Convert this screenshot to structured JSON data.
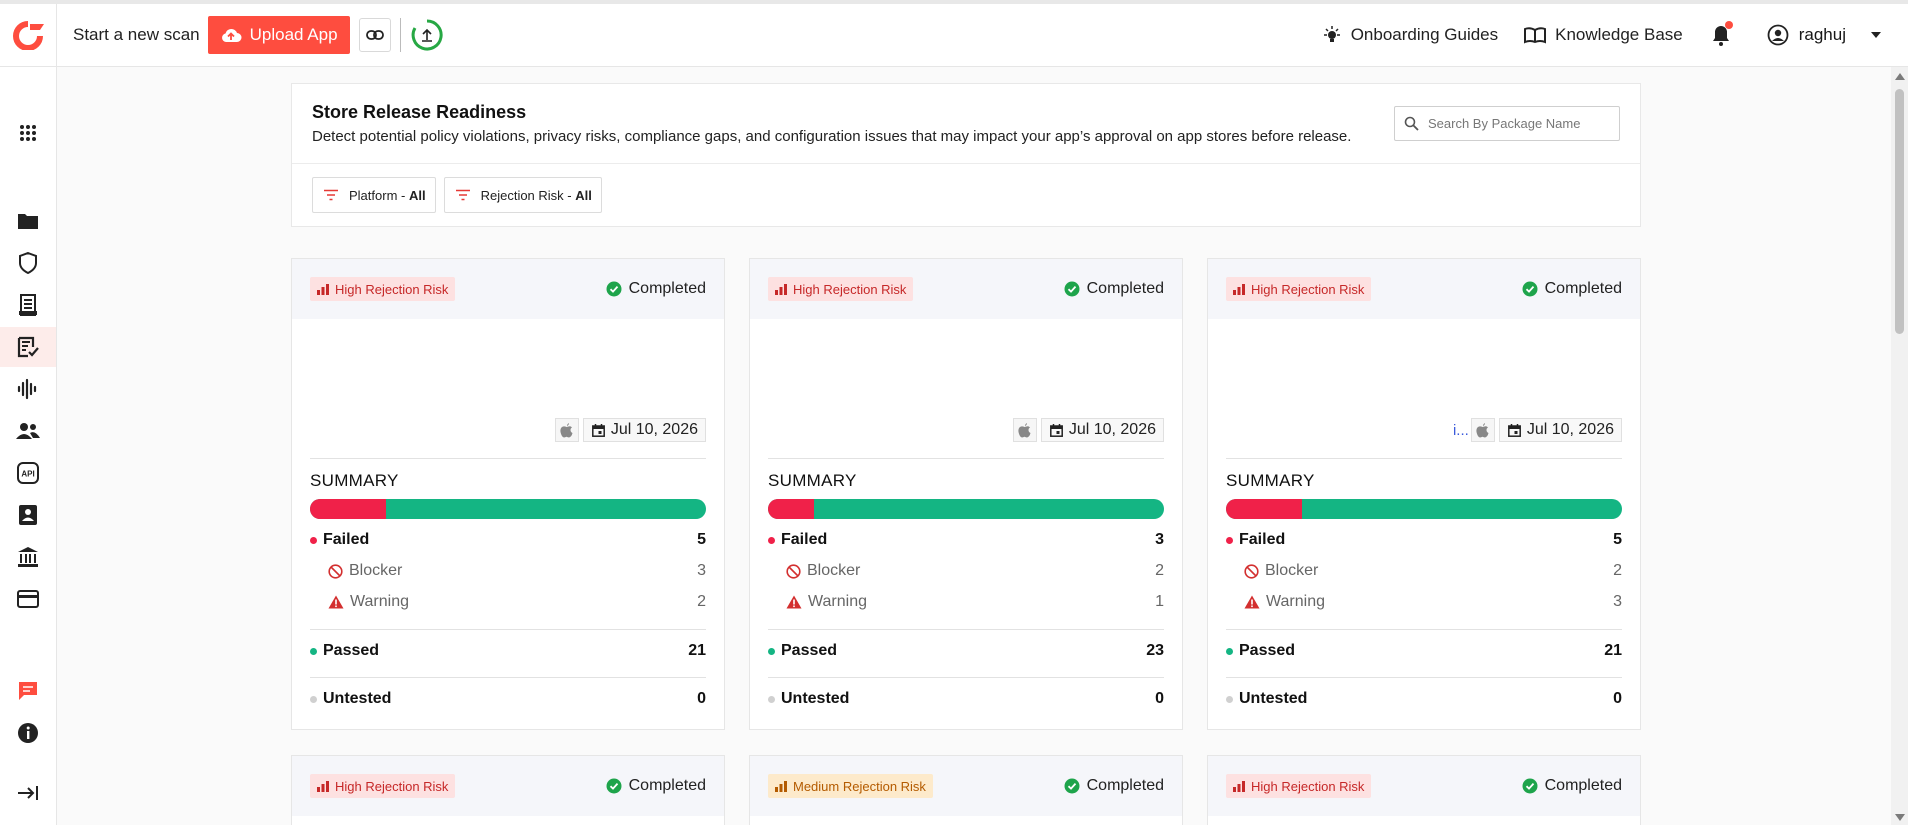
{
  "topbar": {
    "scan_label": "Start a new scan",
    "upload_label": "Upload App",
    "onboarding_label": "Onboarding Guides",
    "knowledge_label": "Knowledge Base",
    "username": "raghuj",
    "accent": "#fe4d3f"
  },
  "sidebar": {
    "items": [
      {
        "icon": "apps-grid-icon"
      },
      {
        "icon": "folder-icon"
      },
      {
        "icon": "shield-icon"
      },
      {
        "icon": "report-icon"
      },
      {
        "icon": "release-readiness-icon",
        "active": true
      },
      {
        "icon": "audio-wave-icon"
      },
      {
        "icon": "users-icon"
      },
      {
        "icon": "api-icon"
      },
      {
        "icon": "contact-card-icon"
      },
      {
        "icon": "bank-icon"
      },
      {
        "icon": "credit-card-icon"
      },
      {
        "icon": "chat-icon"
      },
      {
        "icon": "info-icon"
      },
      {
        "icon": "collapse-sidebar-icon"
      }
    ]
  },
  "page": {
    "title": "Store Release Readiness",
    "description": "Detect potential policy violations, privacy risks, compliance gaps, and configuration issues that may impact your app’s approval on app stores before release.",
    "search_placeholder": "Search By Package Name",
    "filters": [
      {
        "label": "Platform - ",
        "value": "All"
      },
      {
        "label": "Rejection Risk - ",
        "value": "All"
      }
    ]
  },
  "summary_labels": {
    "title": "SUMMARY",
    "failed": "Failed",
    "blocker": "Blocker",
    "warning": "Warning",
    "passed": "Passed",
    "untested": "Untested"
  },
  "cards": [
    {
      "risk": "High Rejection Risk",
      "risk_level": "high",
      "status": "Completed",
      "platform": "apple-icon",
      "date": "Jul 10, 2026",
      "truncated": "",
      "failed": 5,
      "blocker": 3,
      "warning": 2,
      "passed": 21,
      "untested": 0
    },
    {
      "risk": "High Rejection Risk",
      "risk_level": "high",
      "status": "Completed",
      "platform": "apple-icon",
      "date": "Jul 10, 2026",
      "truncated": "",
      "failed": 3,
      "blocker": 2,
      "warning": 1,
      "passed": 23,
      "untested": 0
    },
    {
      "risk": "High Rejection Risk",
      "risk_level": "high",
      "status": "Completed",
      "platform": "apple-icon",
      "date": "Jul 10, 2026",
      "truncated": "i...",
      "failed": 5,
      "blocker": 2,
      "warning": 3,
      "passed": 21,
      "untested": 0
    },
    {
      "risk": "High Rejection Risk",
      "risk_level": "high",
      "status": "Completed"
    },
    {
      "risk": "Medium Rejection Risk",
      "risk_level": "medium",
      "status": "Completed"
    },
    {
      "risk": "High Rejection Risk",
      "risk_level": "high",
      "status": "Completed"
    }
  ],
  "colors": {
    "failed": "#f02149",
    "passed": "#14b583",
    "untested": "#d0d0d0",
    "completed": "#1ea44b"
  }
}
